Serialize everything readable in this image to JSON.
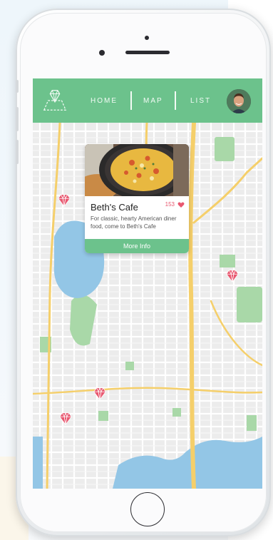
{
  "nav": {
    "home_label": "HOME",
    "map_label": "MAP",
    "list_label": "LIST"
  },
  "card": {
    "title": "Beth's Cafe",
    "likes": "153",
    "description": "For classic, hearty American diner food, come to Beth's Cafe",
    "button_label": "More Info"
  },
  "colors": {
    "brand": "#6cc28c",
    "pin": "#e8576f",
    "water": "#93c6e6",
    "park": "#a9d8a8",
    "highway": "#f5cf6a"
  },
  "icons": {
    "logo": "diamond-map-icon",
    "map_pin": "diamond-pin-icon",
    "likes": "heart-icon"
  }
}
